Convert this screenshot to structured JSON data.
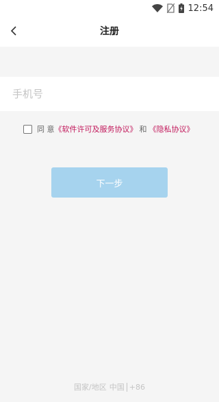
{
  "status_bar": {
    "time": "12:54"
  },
  "header": {
    "title": "注册",
    "back_icon": "chevron-left-icon"
  },
  "form": {
    "phone_placeholder": "手机号",
    "phone_value": ""
  },
  "agreement": {
    "prefix": "同 意",
    "terms_link": "《软件许可及服务协议》",
    "and_text": "和",
    "privacy_link": "《隐私协议》",
    "link_color": "#c2185b"
  },
  "actions": {
    "next_label": "下一步",
    "next_color": "#a6d3ee"
  },
  "region": {
    "label": "国家/地区",
    "country": "中国",
    "code": "+86"
  }
}
